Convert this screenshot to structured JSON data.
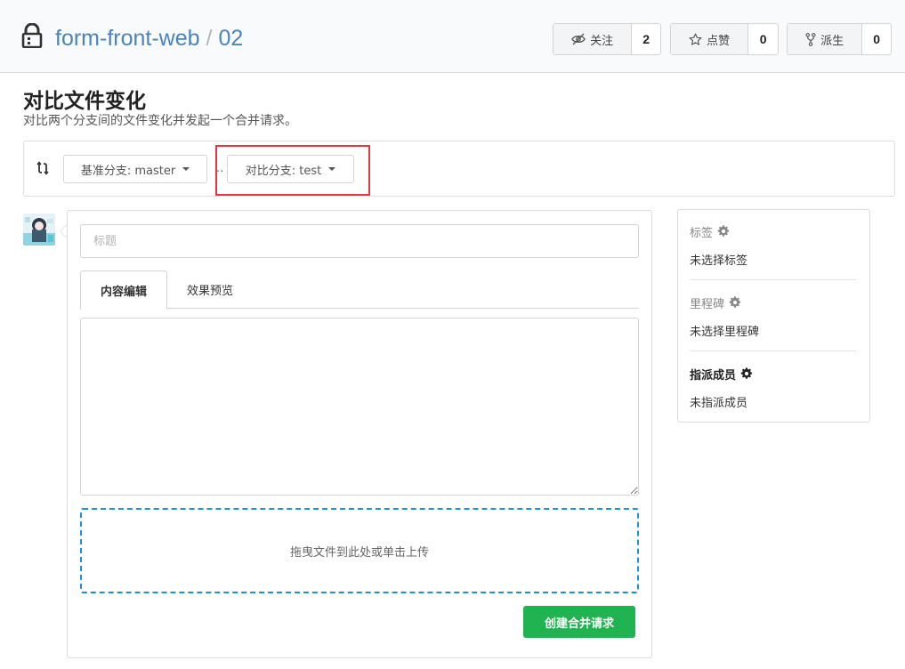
{
  "header": {
    "repo_name": "form-front-web",
    "separator": "/",
    "repo_sub": "02",
    "watch": {
      "label": "关注",
      "count": "2",
      "icon": "eye-slash-icon"
    },
    "star": {
      "label": "点赞",
      "count": "0",
      "icon": "star-icon"
    },
    "fork": {
      "label": "派生",
      "count": "0",
      "icon": "fork-icon"
    }
  },
  "page": {
    "title": "对比文件变化",
    "subtitle": "对比两个分支间的文件变化并发起一个合并请求。"
  },
  "compare": {
    "base_label": "基准分支: master",
    "dots": "..",
    "head_label": "对比分支: test",
    "highlight_color": "#e0393e"
  },
  "form": {
    "title_placeholder": "标题",
    "tabs": [
      {
        "label": "内容编辑",
        "active": true
      },
      {
        "label": "效果预览",
        "active": false
      }
    ],
    "content_value": "",
    "dropzone_text": "拖曳文件到此处或单击上传",
    "submit_label": "创建合并请求",
    "submit_color": "#21b351"
  },
  "sidebar": {
    "labels": {
      "title": "标签",
      "value": "未选择标签"
    },
    "milestone": {
      "title": "里程碑",
      "value": "未选择里程碑"
    },
    "assignees": {
      "title": "指派成员",
      "value": "未指派成员"
    }
  }
}
